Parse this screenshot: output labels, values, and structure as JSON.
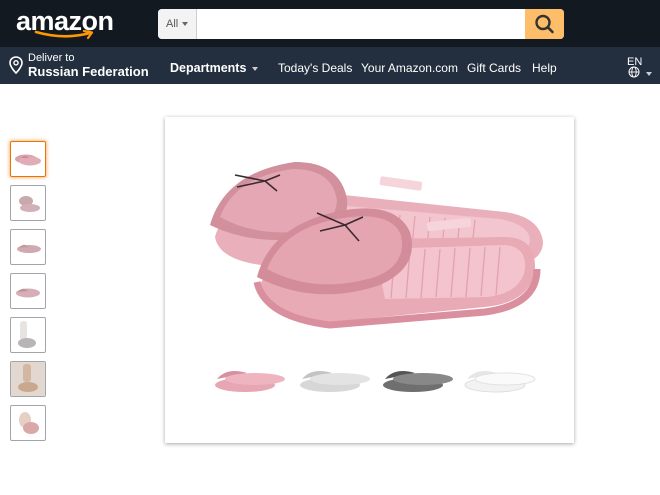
{
  "header": {
    "logo_text": "amazon",
    "search": {
      "category": "All",
      "value": "",
      "placeholder": ""
    },
    "search_icon": "search-icon"
  },
  "subnav": {
    "deliver_label": "Deliver to",
    "deliver_location": "Russian Federation",
    "departments": "Departments",
    "items": [
      "Today's Deals",
      "Your Amazon.com",
      "Gift Cards",
      "Help"
    ],
    "language": "EN"
  },
  "product": {
    "thumbnail_count": 7,
    "selected_thumbnail": 0,
    "variant_colors": [
      "#e7a6b4",
      "#d7d7d7",
      "#6f6f6f",
      "#f2f2f2"
    ],
    "main_color": "#eaa9b5"
  },
  "colors": {
    "topbar": "#131921",
    "subnav": "#232f3e",
    "search_button": "#febd69",
    "selected_border": "#e77600"
  }
}
